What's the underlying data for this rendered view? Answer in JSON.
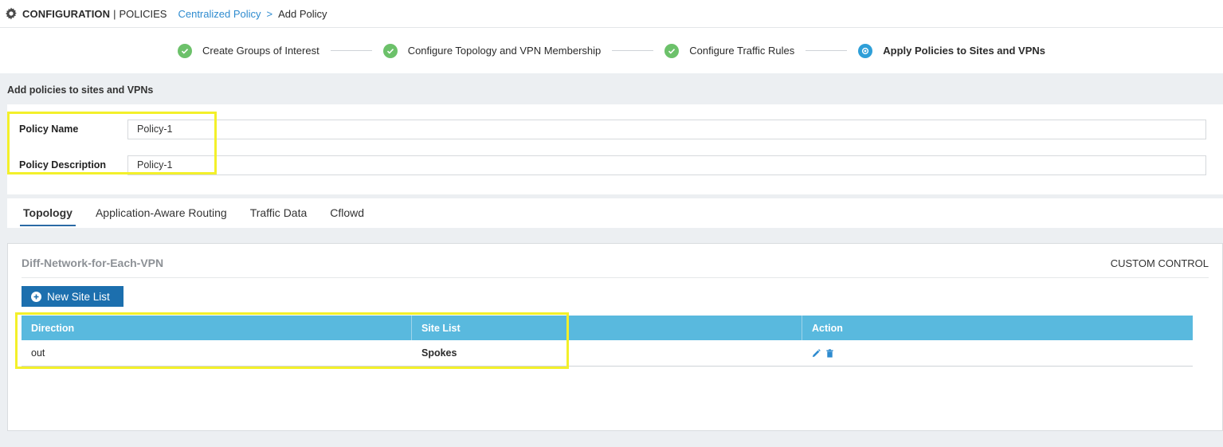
{
  "header": {
    "section": "CONFIGURATION",
    "separator": "|",
    "page": "POLICIES",
    "breadcrumb_link": "Centralized Policy",
    "breadcrumb_arrow": ">",
    "breadcrumb_current": "Add Policy"
  },
  "stepper": {
    "steps": [
      {
        "label": "Create Groups of Interest",
        "status": "done"
      },
      {
        "label": "Configure Topology and VPN Membership",
        "status": "done"
      },
      {
        "label": "Configure Traffic Rules",
        "status": "done"
      },
      {
        "label": "Apply Policies to Sites and VPNs",
        "status": "active"
      }
    ]
  },
  "form": {
    "section_label": "Add policies to sites and VPNs",
    "policy_name_label": "Policy Name",
    "policy_name_value": "Policy-1",
    "policy_description_label": "Policy Description",
    "policy_description_value": "Policy-1"
  },
  "tabs": [
    {
      "label": "Topology",
      "active": true
    },
    {
      "label": "Application-Aware Routing",
      "active": false
    },
    {
      "label": "Traffic Data",
      "active": false
    },
    {
      "label": "Cflowd",
      "active": false
    }
  ],
  "content": {
    "title": "Diff-Network-for-Each-VPN",
    "custom_control": "CUSTOM CONTROL",
    "new_site_list_label": "New Site List",
    "table": {
      "headers": [
        "Direction",
        "Site List",
        "Action"
      ],
      "rows": [
        {
          "direction": "out",
          "site_list": "Spokes"
        }
      ]
    }
  },
  "colors": {
    "accent_blue": "#1c6fae",
    "link_blue": "#2e8bcf",
    "table_header": "#59b9de",
    "step_done": "#6cc16a",
    "step_active": "#2e9fd8",
    "highlight": "#f3f02a"
  }
}
